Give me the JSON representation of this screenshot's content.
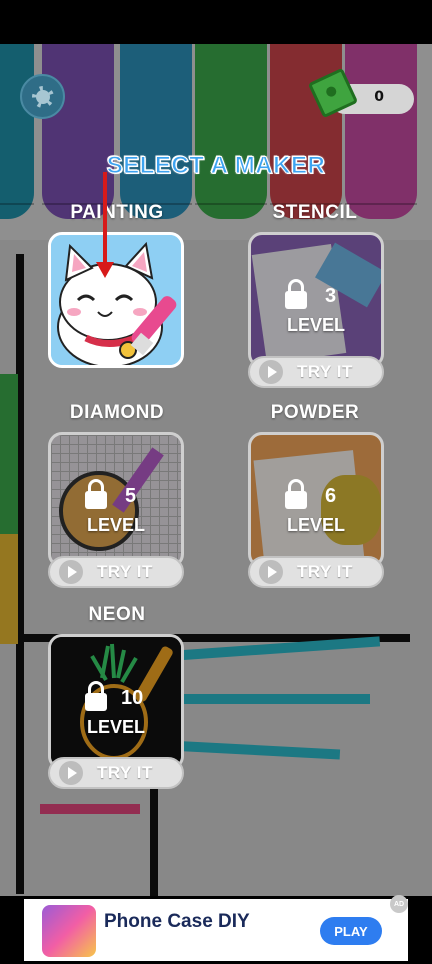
{
  "header": {
    "money_count": "0",
    "title": "SELECT A MAKER"
  },
  "makers": [
    {
      "name": "PAINTING",
      "locked": false
    },
    {
      "name": "STENCIL",
      "locked": true,
      "level": "3",
      "level_label": "LEVEL",
      "try_label": "TRY IT"
    },
    {
      "name": "DIAMOND",
      "locked": true,
      "level": "5",
      "level_label": "LEVEL",
      "try_label": "TRY IT"
    },
    {
      "name": "POWDER",
      "locked": true,
      "level": "6",
      "level_label": "LEVEL",
      "try_label": "TRY IT"
    },
    {
      "name": "NEON",
      "locked": true,
      "level": "10",
      "level_label": "LEVEL",
      "try_label": "TRY IT"
    }
  ],
  "ad": {
    "title": "Phone Case DIY",
    "cta": "PLAY",
    "badge": "AD"
  },
  "colors": {
    "title_blue": "#3da3f0",
    "arrow_red": "#d71a1a",
    "pen_teal": "#1f8fa8",
    "pen_purple": "#7a4fb0",
    "pen_green": "#3aa64a",
    "pen_red": "#c9434a",
    "pen_pink": "#c24aa0",
    "ad_button": "#2e7df0"
  },
  "icons": [
    "gear-icon",
    "cash-icon",
    "lock-icon",
    "play-video-icon",
    "red-arrow"
  ]
}
